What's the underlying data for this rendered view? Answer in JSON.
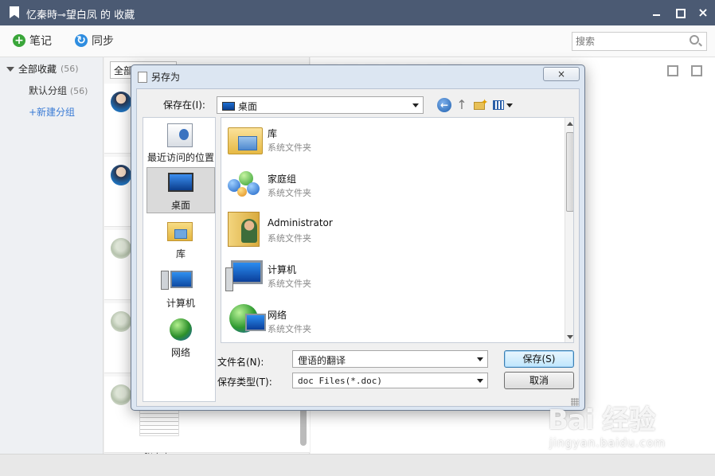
{
  "app": {
    "title": "忆秦時⊸望白凤 的 收藏",
    "close_glyph": "×"
  },
  "toolbar": {
    "note_label": "笔记",
    "sync_label": "同步",
    "search_placeholder": "搜索"
  },
  "sidebar": {
    "all_label": "全部收藏",
    "all_count": "(56)",
    "default_label": "默认分组",
    "default_count": "(56)",
    "new_group_label": "+新建分组"
  },
  "list": {
    "filter_value": "全部",
    "bottom_text": "张宇小"
  },
  "dialog": {
    "title": "另存为",
    "close_glyph": "×",
    "save_in_label": "保存在(I):",
    "save_in_value": "桌面",
    "places": [
      {
        "label": "最近访问的位置",
        "icon": "recent-places-icon"
      },
      {
        "label": "桌面",
        "icon": "desktop-icon",
        "selected": true
      },
      {
        "label": "库",
        "icon": "library-icon"
      },
      {
        "label": "计算机",
        "icon": "computer-icon"
      },
      {
        "label": "网络",
        "icon": "network-icon"
      }
    ],
    "files": [
      {
        "name": "库",
        "type": "系统文件夹",
        "icon": "library-folder-icon"
      },
      {
        "name": "家庭组",
        "type": "系统文件夹",
        "icon": "homegroup-icon"
      },
      {
        "name": "Administrator",
        "type": "系统文件夹",
        "icon": "user-folder-icon"
      },
      {
        "name": "计算机",
        "type": "系统文件夹",
        "icon": "computer-icon"
      },
      {
        "name": "网络",
        "type": "系统文件夹",
        "icon": "network-icon"
      }
    ],
    "filename_label": "文件名(N):",
    "filename_value": "俚语的翻译",
    "filetype_label": "保存类型(T):",
    "filetype_value": "doc Files(*.doc)",
    "save_button": "保存(S)",
    "cancel_button": "取消"
  },
  "watermark": {
    "logo": "Bai 经验",
    "sub": "jingyan.baidu.com"
  }
}
